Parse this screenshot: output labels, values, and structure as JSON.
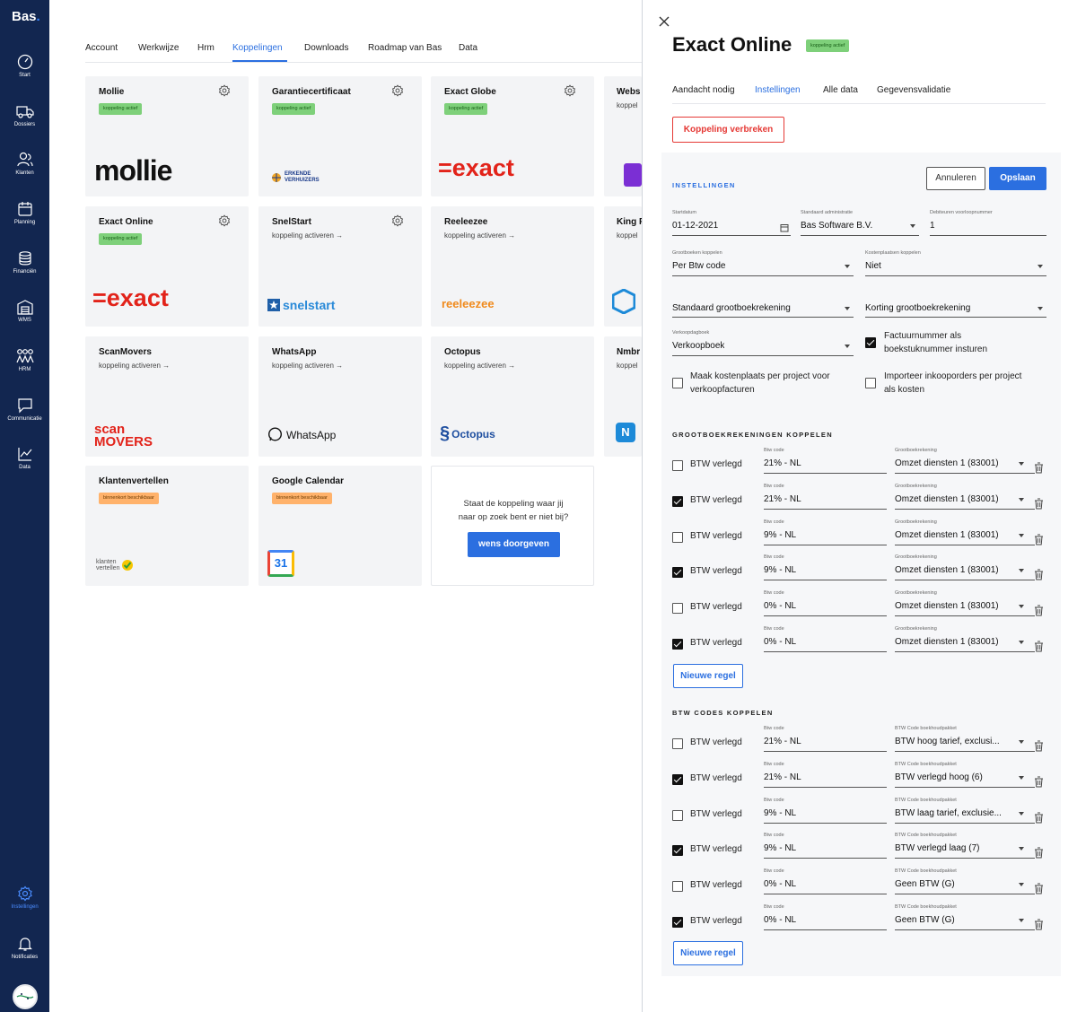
{
  "sidebar": {
    "logo": "Bas",
    "items": [
      {
        "label": "Start",
        "icon": "gauge-icon"
      },
      {
        "label": "Dossiers",
        "icon": "truck-icon"
      },
      {
        "label": "Klanten",
        "icon": "users-icon"
      },
      {
        "label": "Planning",
        "icon": "calendar-icon"
      },
      {
        "label": "Financiën",
        "icon": "coins-icon"
      },
      {
        "label": "WMS",
        "icon": "warehouse-icon"
      },
      {
        "label": "HRM",
        "icon": "team-icon"
      },
      {
        "label": "Communicatie",
        "icon": "chat-icon"
      },
      {
        "label": "Data",
        "icon": "chart-icon"
      }
    ],
    "bottom": [
      {
        "label": "Instellingen",
        "icon": "gear-icon"
      },
      {
        "label": "Notificaties",
        "icon": "bell-icon"
      }
    ]
  },
  "main": {
    "tabs": [
      "Account",
      "Werkwijze",
      "Hrm",
      "Koppelingen",
      "Downloads",
      "Roadmap van Bas",
      "Data"
    ],
    "active_tab": "Koppelingen",
    "cards": [
      {
        "title": "Mollie",
        "badge": "koppeling actief",
        "badge_type": "green",
        "gear": true,
        "logo": "mollie"
      },
      {
        "title": "Garantiecertificaat",
        "badge": "koppeling actief",
        "badge_type": "green",
        "gear": true,
        "logo": "ERKENDE VERHUIZERS"
      },
      {
        "title": "Exact Globe",
        "badge": "koppeling actief",
        "badge_type": "green",
        "gear": true,
        "logo": "=exact"
      },
      {
        "title": "Webs",
        "sub": "koppel"
      },
      {
        "title": "Exact Online",
        "badge": "koppeling actief",
        "badge_type": "green",
        "gear": true,
        "logo": "=exact"
      },
      {
        "title": "SnelStart",
        "sub": "koppeling activeren →",
        "gear": true,
        "logo": "snelstart"
      },
      {
        "title": "Reeleezee",
        "sub": "koppeling activeren →",
        "logo": "reeleezee"
      },
      {
        "title": "King F",
        "sub": "koppel"
      },
      {
        "title": "ScanMovers",
        "sub": "koppeling activeren →",
        "logo": "scan MOVERS"
      },
      {
        "title": "WhatsApp",
        "sub": "koppeling activeren →",
        "logo": "WhatsApp"
      },
      {
        "title": "Octopus",
        "sub": "koppeling activeren →",
        "logo": "Octopus"
      },
      {
        "title": "Nmbr",
        "sub": "koppel"
      },
      {
        "title": "Klantenvertellen",
        "badge": "binnenkort beschikbaar",
        "badge_type": "orange",
        "logo": "klanten vertellen"
      },
      {
        "title": "Google Calendar",
        "badge": "binnenkort beschikbaar",
        "badge_type": "orange",
        "logo": "31"
      }
    ],
    "empty_card": {
      "text_line1": "Staat de koppeling waar jij",
      "text_line2": "naar op zoek bent er niet bij?",
      "button": "wens doorgeven"
    }
  },
  "panel": {
    "title": "Exact Online",
    "badge": "koppeling actief",
    "tabs": [
      "Aandacht nodig",
      "Instellingen",
      "Alle data",
      "Gegevensvalidatie"
    ],
    "active_tab": "Instellingen",
    "disconnect": "Koppeling verbreken",
    "section_settings": "INSTELLINGEN",
    "cancel": "Annuleren",
    "save": "Opslaan",
    "startdatum": {
      "label": "Startdatum",
      "value": "01-12-2021"
    },
    "administratie": {
      "label": "Standaard administratie",
      "value": "Bas Software B.V."
    },
    "debiteuren": {
      "label": "Debiteuren voorloopnummer",
      "value": "1"
    },
    "grootboeken": {
      "label": "Grootboeken koppelen",
      "value": "Per Btw code"
    },
    "kostenplaatsen": {
      "label": "Kostenplaatsen koppelen",
      "value": "Niet"
    },
    "standaard_grootboek": "Standaard grootboekrekening",
    "korting_grootboek": "Korting grootboekrekening",
    "verkoopdagboek": {
      "label": "Verkoopdagboek",
      "value": "Verkoopboek"
    },
    "checks": {
      "factuurnummer": {
        "line1": "Factuurnummer als",
        "line2": "boekstuknummer insturen",
        "checked": true
      },
      "kostenplaats": {
        "line1": "Maak kostenplaats per project voor",
        "line2": "verkoopfacturen",
        "checked": false
      },
      "inkooporders": {
        "line1": "Importeer inkooporders per project",
        "line2": "als kosten",
        "checked": false
      }
    },
    "section_grootboek": "GROOTBOEKREKENINGEN KOPPELEN",
    "grootboek_rows": [
      {
        "label": "BTW verlegd",
        "checked": false,
        "btw_label": "Btw code",
        "btw": "21% - NL",
        "gb_label": "Grootboekrekening",
        "gb": "Omzet diensten 1 (83001)"
      },
      {
        "label": "BTW verlegd",
        "checked": true,
        "btw_label": "Btw code",
        "btw": "21% - NL",
        "gb_label": "Grootboekrekening",
        "gb": "Omzet diensten 1 (83001)"
      },
      {
        "label": "BTW verlegd",
        "checked": false,
        "btw_label": "Btw code",
        "btw": "9% - NL",
        "gb_label": "Grootboekrekening",
        "gb": "Omzet diensten 1 (83001)"
      },
      {
        "label": "BTW verlegd",
        "checked": true,
        "btw_label": "Btw code",
        "btw": "9% - NL",
        "gb_label": "Grootboekrekening",
        "gb": "Omzet diensten 1 (83001)"
      },
      {
        "label": "BTW verlegd",
        "checked": false,
        "btw_label": "Btw code",
        "btw": "0% - NL",
        "gb_label": "Grootboekrekening",
        "gb": "Omzet diensten 1 (83001)"
      },
      {
        "label": "BTW verlegd",
        "checked": true,
        "btw_label": "Btw code",
        "btw": "0% - NL",
        "gb_label": "Grootboekrekening",
        "gb": "Omzet diensten 1 (83001)"
      }
    ],
    "new_row": "Nieuwe regel",
    "section_btw": "BTW CODES KOPPELEN",
    "btw_rows": [
      {
        "label": "BTW verlegd",
        "checked": false,
        "btw_label": "Btw code",
        "btw": "21% - NL",
        "gb_label": "BTW Code boekhoudpakket",
        "gb": "BTW hoog tarief, exclusi..."
      },
      {
        "label": "BTW verlegd",
        "checked": true,
        "btw_label": "Btw code",
        "btw": "21% - NL",
        "gb_label": "BTW Code boekhoudpakket",
        "gb": "BTW verlegd hoog (6)"
      },
      {
        "label": "BTW verlegd",
        "checked": false,
        "btw_label": "Btw code",
        "btw": "9% - NL",
        "gb_label": "BTW Code boekhoudpakket",
        "gb": "BTW laag tarief, exclusie..."
      },
      {
        "label": "BTW verlegd",
        "checked": true,
        "btw_label": "Btw code",
        "btw": "9% - NL",
        "gb_label": "BTW Code boekhoudpakket",
        "gb": "BTW verlegd laag (7)"
      },
      {
        "label": "BTW verlegd",
        "checked": false,
        "btw_label": "Btw code",
        "btw": "0% - NL",
        "gb_label": "BTW Code boekhoudpakket",
        "gb": "Geen BTW (G)"
      },
      {
        "label": "BTW verlegd",
        "checked": true,
        "btw_label": "Btw code",
        "btw": "0% - NL",
        "gb_label": "BTW Code boekhoudpakket",
        "gb": "Geen BTW (G)"
      }
    ],
    "new_row_2": "Nieuwe regel"
  },
  "colors": {
    "sidebar": "#122650",
    "accent": "#2b6fe0",
    "danger": "#e53935",
    "badge_green": "#7ed07a",
    "badge_orange": "#ffb26b"
  }
}
